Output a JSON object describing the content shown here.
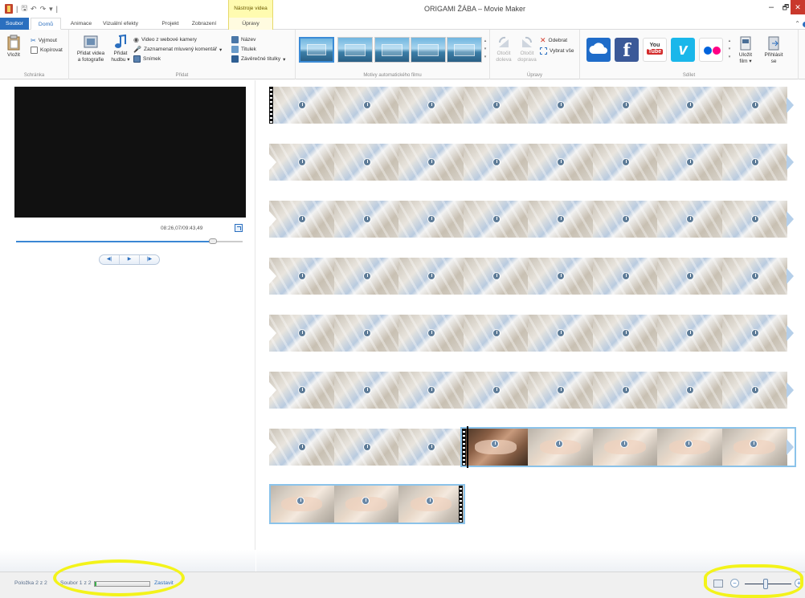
{
  "window": {
    "title": "ORIGAMI ŽÁBA – Movie Maker",
    "context_tab_group": "Nástroje videa"
  },
  "tabs": {
    "file": "Soubor",
    "home": "Domů",
    "animations": "Animace",
    "visual_effects": "Vizuální efekty",
    "project": "Projekt",
    "view": "Zobrazení",
    "edit": "Úpravy"
  },
  "ribbon": {
    "clipboard": {
      "paste": "Vložit",
      "cut": "Vyjmout",
      "copy": "Kopírovat",
      "label": "Schránka"
    },
    "add": {
      "add_videos_line1": "Přidat videa",
      "add_videos_line2": "a fotografie",
      "add_music_line1": "Přidat",
      "add_music_line2": "hudbu",
      "webcam_video": "Video z webové kamery",
      "record_narration": "Zaznamenat mluvený komentář",
      "snapshot": "Snímek",
      "title": "Název",
      "caption": "Titulek",
      "credits": "Závěrečné titulky",
      "label": "Přidat"
    },
    "themes": {
      "label": "Motivy automatického filmu",
      "count": 5,
      "selected_index": 0
    },
    "editing": {
      "rotate_left_line1": "Otočit",
      "rotate_left_line2": "doleva",
      "rotate_right_line1": "Otočit",
      "rotate_right_line2": "doprava",
      "remove": "Odebrat",
      "select_all": "Vybrat vše",
      "label": "Úpravy"
    },
    "share": {
      "label": "Sdílet",
      "youtube_top": "You",
      "youtube_bottom": "Tube",
      "save_movie_line1": "Uložit",
      "save_movie_line2": "film",
      "sign_in_line1": "Přihlásit",
      "sign_in_line2": "se",
      "colors": {
        "onedrive": "#1f6cc9",
        "facebook": "#3b5998",
        "youtube": "#d32a2a",
        "vimeo": "#1ab7ea",
        "flickr_pink": "#ff0084",
        "flickr_blue": "#0063dc"
      }
    }
  },
  "preview": {
    "time_readout": "08:26,07/09:43,49",
    "seek_progress": 0.868
  },
  "storyboard": {
    "clips_per_row": 8,
    "rows": [
      {
        "clips": [
          "wood",
          "wood",
          "wood",
          "wood",
          "wood",
          "wood",
          "wood",
          "wood"
        ],
        "start_marker": true
      },
      {
        "clips": [
          "wood",
          "wood",
          "wood",
          "wood",
          "wood",
          "wood",
          "wood",
          "wood"
        ]
      },
      {
        "clips": [
          "wood",
          "wood",
          "wood",
          "wood",
          "wood",
          "wood",
          "wood",
          "wood"
        ]
      },
      {
        "clips": [
          "wood",
          "wood",
          "wood",
          "wood",
          "wood",
          "wood",
          "wood",
          "wood"
        ]
      },
      {
        "clips": [
          "wood",
          "wood",
          "wood",
          "wood",
          "wood",
          "wood",
          "wood",
          "wood"
        ]
      },
      {
        "clips": [
          "wood",
          "wood",
          "wood",
          "wood",
          "wood",
          "wood",
          "wood",
          "wood"
        ]
      },
      {
        "clips": [
          "wood",
          "wood",
          "wood",
          "hand-dark",
          "hand",
          "hand",
          "hand",
          "hand"
        ],
        "cursor_after": 3,
        "selected_from": 3
      },
      {
        "clips": [
          "hand",
          "hand",
          "hand"
        ],
        "selected_from": 0,
        "end_marker": true
      }
    ]
  },
  "status": {
    "item": "Položka 2 z 2",
    "file": "Soubor 1 z 2",
    "progress": 0.02,
    "stop": "Zastavit",
    "zoom_level": 0.45
  },
  "colors": {
    "accent": "#2b6fbf",
    "highlight": "#f3f31a"
  }
}
